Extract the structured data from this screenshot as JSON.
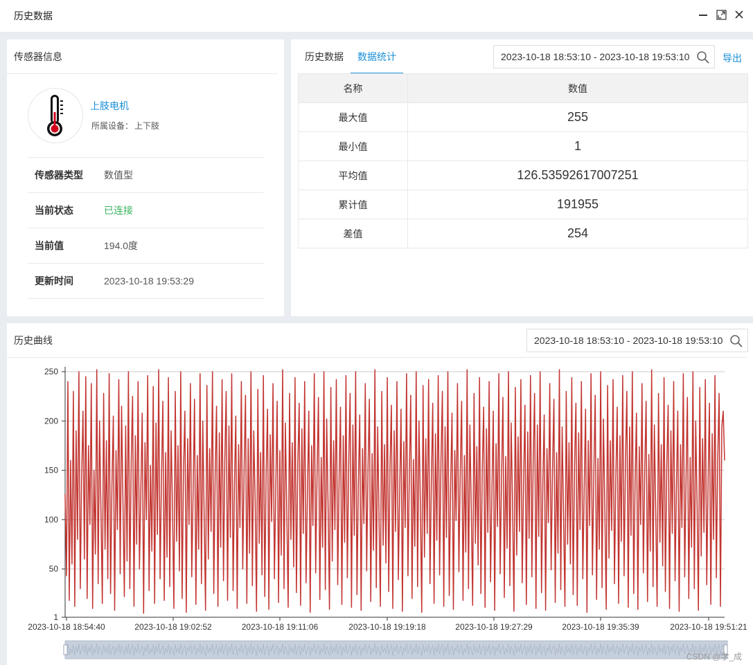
{
  "window": {
    "title": "历史数据",
    "controls": [
      "minimize-icon",
      "maximize-icon",
      "close-icon"
    ]
  },
  "sensor_panel": {
    "title": "传感器信息",
    "icon": "thermometer-icon",
    "name": "上肢电机",
    "device_label": "所属设备：",
    "device_value": "上下肢",
    "rows": [
      {
        "key": "传感器类型",
        "value": "数值型"
      },
      {
        "key": "当前状态",
        "value": "已连接",
        "status_color": "#3cb35f"
      },
      {
        "key": "当前值",
        "value": "194.0度"
      },
      {
        "key": "更新时间",
        "value": "2023-10-18 19:53:29"
      }
    ]
  },
  "stats_panel": {
    "tabs": [
      {
        "label": "历史数据",
        "active": false
      },
      {
        "label": "数据统计",
        "active": true
      }
    ],
    "date_range": "2023-10-18 18:53:10 - 2023-10-18 19:53:10",
    "export_label": "导出",
    "table": {
      "headers": [
        "名称",
        "数值"
      ],
      "rows": [
        {
          "name": "最大值",
          "value": "255"
        },
        {
          "name": "最小值",
          "value": "1"
        },
        {
          "name": "平均值",
          "value": "126.53592617007251"
        },
        {
          "name": "累计值",
          "value": "191955"
        },
        {
          "name": "差值",
          "value": "254"
        }
      ]
    }
  },
  "curve_panel": {
    "title": "历史曲线",
    "date_range": "2023-10-18 18:53:10 - 2023-10-18 19:53:10"
  },
  "chart_data": {
    "type": "line",
    "title": "",
    "xlabel": "",
    "ylabel": "",
    "yticks": [
      1,
      50,
      100,
      150,
      200,
      250
    ],
    "ylim": [
      1,
      255
    ],
    "xticks": [
      "2023-10-18 18:54:40",
      "2023-10-18 19:02:52",
      "2023-10-18 19:11:06",
      "2023-10-18 19:19:18",
      "2023-10-18 19:27:29",
      "2023-10-18 19:35:39",
      "2023-10-18 19:51:21"
    ],
    "grid": true,
    "line_color": "#c23531",
    "series": [
      {
        "values": [
          126,
          43,
          240,
          18,
          160,
          55,
          230,
          12,
          190,
          80,
          250,
          30,
          140,
          210,
          60,
          245,
          20,
          175,
          95,
          238,
          10,
          150,
          65,
          252,
          35,
          200,
          110,
          15,
          228,
          70,
          180,
          40,
          248,
          25,
          135,
          205,
          8,
          170,
          90,
          242,
          45,
          215,
          118,
          22,
          195,
          58,
          250,
          30,
          160,
          225,
          12,
          185,
          75,
          240,
          50,
          130,
          208,
          5,
          178,
          100,
          246,
          28,
          155,
          68,
          235,
          15,
          198,
          85,
          252,
          40,
          142,
          220,
          18,
          168,
          62,
          244,
          32,
          190,
          112,
          10,
          230,
          78,
          175,
          48,
          250,
          20,
          150,
          210,
          6,
          182,
          95,
          238,
          42,
          128,
          222,
          14,
          165,
          70,
          248,
          35,
          200,
          105,
          8,
          236,
          60,
          172,
          88,
          250,
          25,
          145,
          215,
          12,
          188,
          72,
          242,
          38,
          160,
          230,
          18,
          195,
          82,
          248,
          28,
          138,
          205,
          10,
          176,
          92,
          240,
          50,
          152,
          226,
          15,
          182,
          66,
          250,
          33,
          190,
          120,
          7,
          232,
          76,
          168,
          44,
          246,
          22,
          148,
          212,
          9,
          186,
          98,
          238,
          40,
          132,
          220,
          16,
          170,
          64,
          252,
          30,
          198,
          108,
          11,
          228,
          80,
          178,
          52,
          244,
          26,
          156,
          218,
          13,
          192,
          86,
          240,
          36,
          126,
          210,
          6,
          175,
          94,
          248,
          46,
          146,
          224,
          19,
          163,
          72,
          250,
          29,
          202,
          115,
          9,
          234,
          58,
          180,
          90,
          242,
          34,
          140,
          214,
          14,
          185,
          77,
          246,
          41,
          158,
          228,
          11,
          196,
          84,
          250,
          24,
          136,
          206,
          8,
          172,
          96,
          238,
          48,
          150,
          222,
          17,
          167,
          69,
          252,
          31,
          194,
          104,
          12,
          230,
          74,
          176,
          56,
          244,
          27,
          154,
          216,
          10,
          190,
          88,
          240,
          39,
          130,
          212,
          7,
          179,
          92,
          248,
          43,
          144,
          226,
          20,
          161,
          73,
          250,
          32,
          200,
          118,
          6,
          236,
          62,
          182,
          86,
          242,
          35,
          138,
          218,
          15,
          187,
          79,
          246,
          44,
          162,
          230,
          12,
          194,
          82,
          250,
          23,
          134,
          208,
          9,
          170,
          99,
          238,
          47,
          148,
          220,
          18,
          165,
          67,
          252,
          30,
          196,
          110,
          13,
          228,
          76,
          174,
          54,
          244,
          25,
          152,
          214,
          11,
          192,
          87,
          240,
          37,
          128,
          210,
          8,
          177,
          93,
          248,
          45,
          142,
          224,
          21,
          164,
          71,
          250,
          33,
          198,
          116,
          7,
          234,
          64,
          184,
          88,
          242,
          36,
          136,
          216,
          14,
          189,
          81,
          246,
          42,
          160,
          228,
          10,
          196,
          83,
          250,
          26,
          140,
          206,
          8,
          172,
          97,
          238,
          49,
          150,
          222,
          16,
          168,
          66,
          252,
          29,
          194,
          106,
          12,
          230,
          75,
          178,
          55,
          244,
          24,
          156,
          218,
          13,
          188,
          90,
          240,
          40,
          132,
          212,
          6,
          180,
          94,
          248,
          44,
          146,
          226,
          19,
          162,
          70,
          250,
          31,
          202,
          112,
          9,
          236,
          61,
          180,
          89,
          242,
          35,
          142,
          214,
          15,
          185,
          78,
          246,
          43,
          158,
          230,
          11,
          194,
          84,
          250,
          25,
          138,
          208,
          9,
          174,
          95,
          238,
          46,
          148,
          220,
          17,
          166,
          68,
          252,
          32,
          196,
          108,
          12,
          228,
          77,
          176,
          53,
          244,
          27,
          154,
          216,
          10,
          190,
          86,
          240,
          38,
          130,
          210,
          7,
          176,
          92,
          248,
          42,
          144,
          224,
          20,
          163,
          72,
          250,
          30,
          200,
          114,
          8,
          234,
          63,
          182,
          87,
          242,
          34,
          140,
          218,
          14,
          187,
          80,
          246,
          41,
          162,
          228,
          12,
          194,
          210,
          160
        ]
      }
    ]
  },
  "watermark": "CSDN @学_成"
}
